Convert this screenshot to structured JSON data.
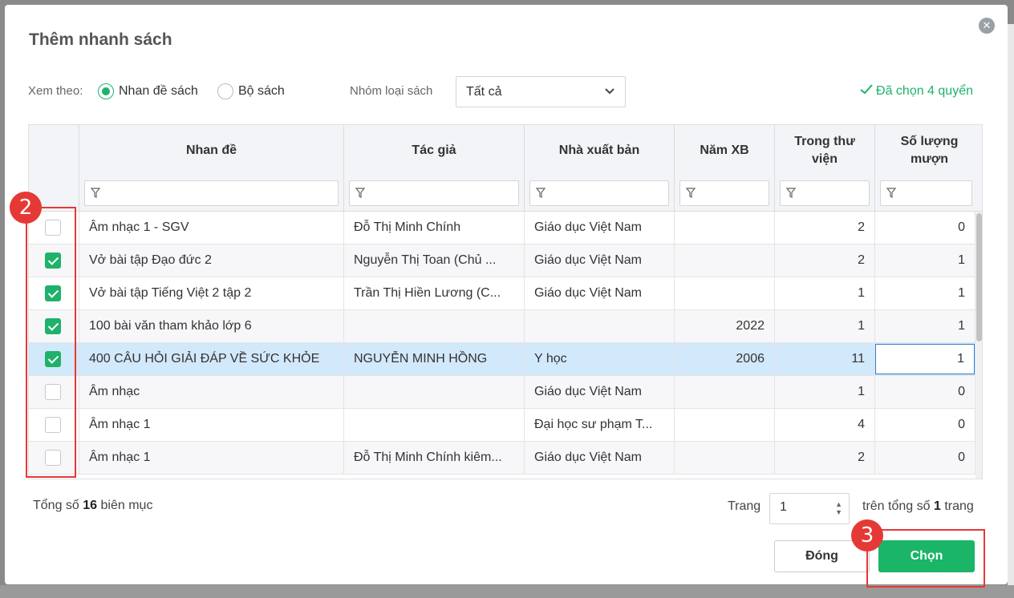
{
  "dialog": {
    "title": "Thêm nhanh sách"
  },
  "filters": {
    "view_by_label": "Xem theo:",
    "radio_options": [
      {
        "label": "Nhan đề sách",
        "selected": true
      },
      {
        "label": "Bộ sách",
        "selected": false
      }
    ],
    "group_label": "Nhóm loại sách",
    "group_value": "Tất cả",
    "selected_count": "Đã chọn 4 quyển"
  },
  "table": {
    "columns": [
      "Nhan đề",
      "Tác giả",
      "Nhà xuất bản",
      "Năm XB",
      "Trong thư viện",
      "Số lượng mượn"
    ],
    "rows": [
      {
        "checked": false,
        "title": "Âm nhạc 1 - SGV",
        "author": "Đỗ Thị Minh Chính",
        "publisher": "Giáo dục Việt Nam",
        "year": "",
        "in_library": "2",
        "borrow_qty": "0"
      },
      {
        "checked": true,
        "title": "Vở bài tập Đạo đức 2",
        "author": "Nguyễn Thị Toan (Chủ ...",
        "publisher": "Giáo dục Việt Nam",
        "year": "",
        "in_library": "2",
        "borrow_qty": "1"
      },
      {
        "checked": true,
        "title": "Vở bài tập Tiếng Việt 2 tập 2",
        "author": "Trần Thị Hiền Lương (C...",
        "publisher": "Giáo dục Việt Nam",
        "year": "",
        "in_library": "1",
        "borrow_qty": "1"
      },
      {
        "checked": true,
        "title": "100 bài văn tham khảo lớp 6",
        "author": "",
        "publisher": "",
        "year": "2022",
        "in_library": "1",
        "borrow_qty": "1"
      },
      {
        "checked": true,
        "title": "400 CÂU HỎI GIẢI ĐÁP VỀ SỨC KHỎE",
        "author": "NGUYỄN MINH HỒNG",
        "publisher": "Y học",
        "year": "2006",
        "in_library": "11",
        "borrow_qty": "1"
      },
      {
        "checked": false,
        "title": "Âm nhạc",
        "author": "",
        "publisher": "Giáo dục Việt Nam",
        "year": "",
        "in_library": "1",
        "borrow_qty": "0"
      },
      {
        "checked": false,
        "title": "Âm nhạc 1",
        "author": "",
        "publisher": "Đại học sư phạm T...",
        "year": "",
        "in_library": "4",
        "borrow_qty": "0"
      },
      {
        "checked": false,
        "title": "Âm nhạc 1",
        "author": "Đỗ Thị Minh Chính kiêm...",
        "publisher": "Giáo dục Việt Nam",
        "year": "",
        "in_library": "2",
        "borrow_qty": "0"
      }
    ]
  },
  "footer": {
    "total_prefix": "Tổng số",
    "total_count": "16",
    "total_suffix": "biên mục",
    "page_label": "Trang",
    "page_value": "1",
    "page_total_prefix": "trên tổng số",
    "page_total_count": "1",
    "page_total_suffix": "trang"
  },
  "buttons": {
    "close_label": "Đóng",
    "choose_label": "Chọn"
  },
  "annotations": {
    "badge_left": "2",
    "badge_right": "3"
  },
  "colors": {
    "accent_green": "#1ab566",
    "annotation_red": "#e53935",
    "selected_row": "#d2e8fb"
  }
}
